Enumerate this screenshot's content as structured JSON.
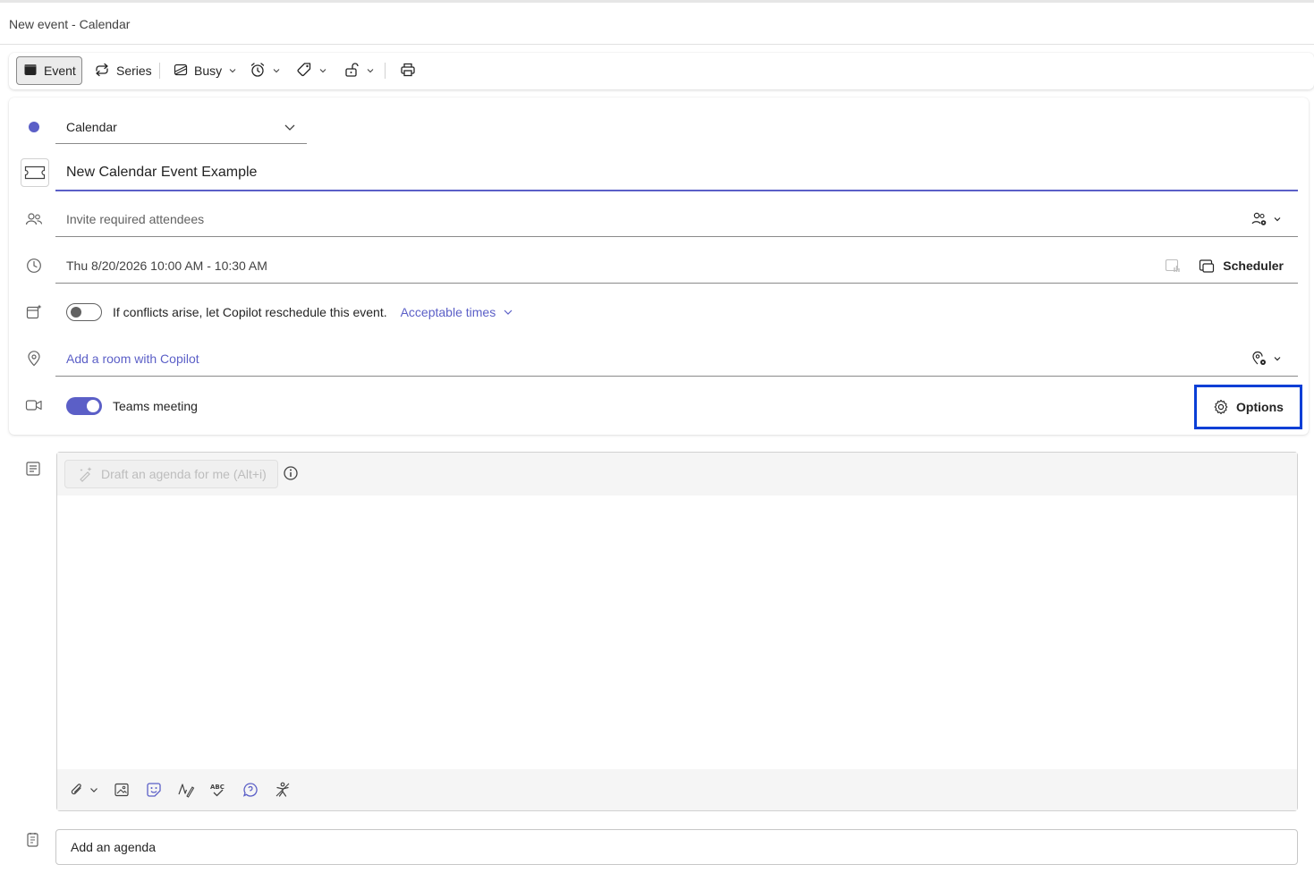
{
  "window": {
    "title": "New event - Calendar"
  },
  "toolbar": {
    "event_label": "Event",
    "series_label": "Series",
    "busy_label": "Busy"
  },
  "form": {
    "calendar_value": "Calendar",
    "title_value": "New Calendar Event Example",
    "attendees_placeholder": "Invite required attendees",
    "datetime_value": "Thu 8/20/2026 10:00 AM - 10:30 AM",
    "scheduler_label": "Scheduler",
    "conflict_text": "If conflicts arise, let Copilot reschedule this event.",
    "acceptable_times_label": "Acceptable times",
    "conflict_toggle_on": false,
    "location_placeholder": "Add a room with Copilot",
    "teams_label": "Teams meeting",
    "teams_toggle_on": true,
    "options_label": "Options"
  },
  "editor": {
    "draft_label": "Draft an agenda for me (Alt+i)"
  },
  "agenda": {
    "placeholder": "Add an agenda"
  },
  "colors": {
    "accent": "#5b5fc7",
    "highlight_border": "#0a3fd6"
  }
}
